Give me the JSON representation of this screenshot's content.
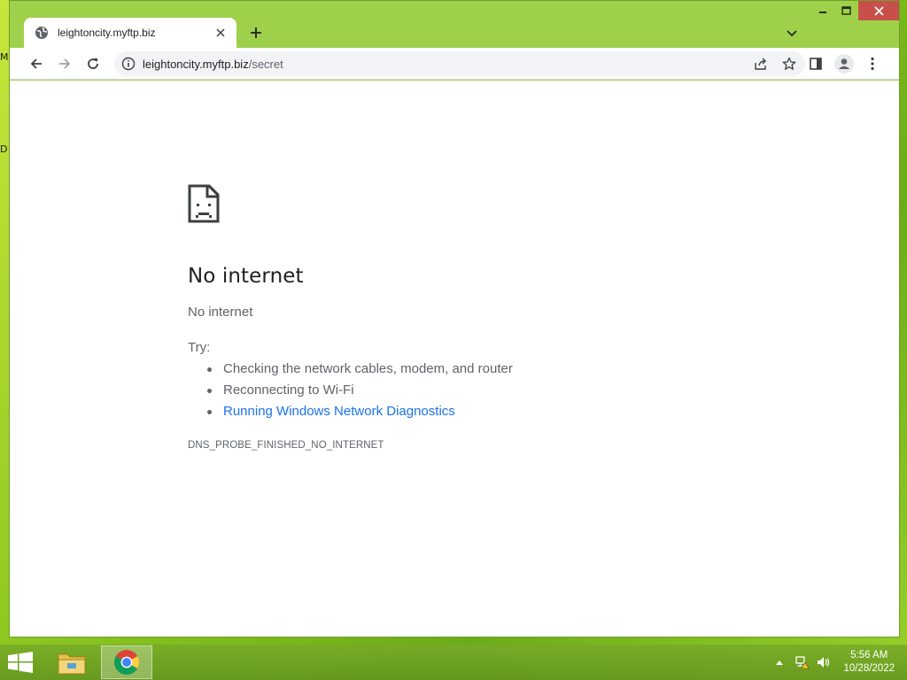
{
  "desktop": {
    "peek_top": "M",
    "peek_mid": "D"
  },
  "window": {
    "tab": {
      "title": "leightoncity.myftp.biz"
    },
    "controls": [
      "minimize",
      "maximize",
      "close"
    ]
  },
  "toolbar": {
    "url_host": "leightoncity.myftp.biz",
    "url_path": "/secret"
  },
  "error_page": {
    "title": "No internet",
    "subtitle": "No internet",
    "try_label": "Try:",
    "suggestions": [
      {
        "text": "Checking the network cables, modem, and router",
        "link": false
      },
      {
        "text": "Reconnecting to Wi-Fi",
        "link": false
      },
      {
        "text": "Running Windows Network Diagnostics",
        "link": true
      }
    ],
    "error_code": "DNS_PROBE_FINISHED_NO_INTERNET"
  },
  "taskbar": {
    "apps": [
      "file-explorer",
      "chrome"
    ],
    "clock_time": "5:56 AM",
    "clock_date": "10/28/2022"
  },
  "colors": {
    "link": "#1a73e8",
    "close_button": "#c7504a",
    "frame": "#9fd04a"
  }
}
